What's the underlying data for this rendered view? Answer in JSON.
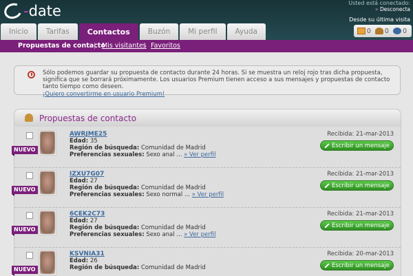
{
  "header": {
    "logo_text": "date",
    "user_status": "Usted está conectado:",
    "logout_label": "Desconecta",
    "last_visit_label": "Desde su última visita"
  },
  "tabs": [
    {
      "label": "Inicio"
    },
    {
      "label": "Tarifas"
    },
    {
      "label": "Contactos",
      "active": true
    },
    {
      "label": "Buzón"
    },
    {
      "label": "Mi perfil"
    },
    {
      "label": "Ayuda"
    }
  ],
  "badges": [
    {
      "icon": "mail-icon",
      "count": "0"
    },
    {
      "icon": "user-icon",
      "count": "0"
    },
    {
      "icon": "eye-icon",
      "count": "0"
    }
  ],
  "subnav": [
    {
      "label": "Propuestas de contacto",
      "active": true
    },
    {
      "label": "Mis visitantes"
    },
    {
      "label": "Favoritos"
    }
  ],
  "notice": {
    "text": "Sólo podemos guardar su propuesta de contacto durante 24 horas. Si se muestra un reloj rojo tras dicha propuesta, significa que se borrará próximamente. Los usuarios Premium tienen acceso a sus mensajes y propuestas de contacto tanto tiempo como deseen.",
    "link": "¡Quiero convertirme en usuario Premium!"
  },
  "panel": {
    "title": "Propuestas de contacto"
  },
  "labels": {
    "nuevo": "NUEVO",
    "edad": "Edad:",
    "region": "Región de búsqueda:",
    "preferencias": "Preferencias sexuales:",
    "ver_perfil": "» Ver perfil",
    "recibida": "Recibida:",
    "escribir": "Escribir un mensaje"
  },
  "proposals": [
    {
      "name": "AWRJME25",
      "age": "35",
      "region": "Comunidad de Madrid",
      "prefs": "Sexo anal ...",
      "date": "21-mar-2013"
    },
    {
      "name": "IZXU7G07",
      "age": "27",
      "region": "Comunidad de Madrid",
      "prefs": "Sexo normal ...",
      "date": "21-mar-2013"
    },
    {
      "name": "6CEK2C73",
      "age": "27",
      "region": "Comunidad de Madrid",
      "prefs": "Sexo anal ...",
      "date": "21-mar-2013"
    },
    {
      "name": "KSVNIA31",
      "age": "26",
      "region": "Comunidad de Madrid",
      "prefs": "",
      "date": "20-mar-2013"
    }
  ],
  "colors": {
    "brand_purple": "#7a1f7a",
    "header_teal": "#1e3d42",
    "button_green": "#3aa12c",
    "link_blue": "#3b6aa0"
  }
}
